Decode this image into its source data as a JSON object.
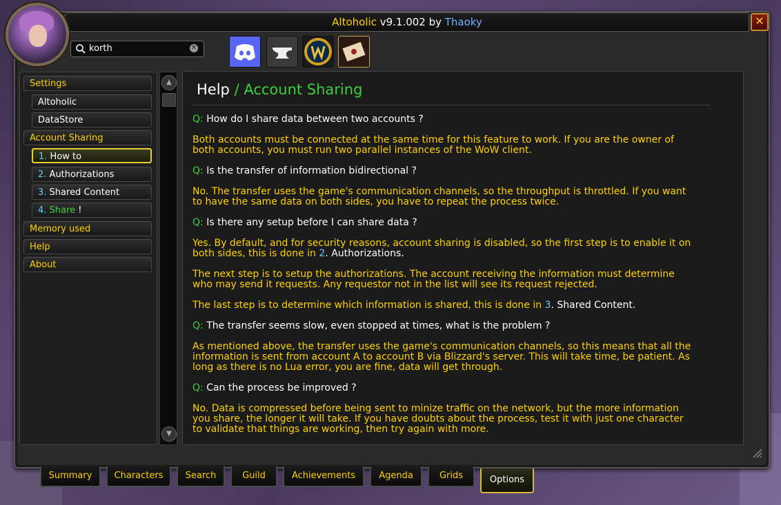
{
  "window": {
    "title_app": "Altoholic",
    "title_version": " v9.1.002 by ",
    "title_author": "Thaoky",
    "close_glyph": "✕"
  },
  "search": {
    "value": "korth",
    "clear_glyph": "✕"
  },
  "toolbar": {
    "buttons": [
      {
        "name": "discord-icon"
      },
      {
        "name": "anvil-icon"
      },
      {
        "name": "wow-logo-icon"
      },
      {
        "name": "scroll-letter-icon"
      }
    ]
  },
  "sidebar": {
    "items": [
      {
        "label": "Settings",
        "kind": "category"
      },
      {
        "label": "Altoholic",
        "kind": "sub"
      },
      {
        "label": "DataStore",
        "kind": "sub"
      },
      {
        "label": "Account Sharing",
        "kind": "category"
      },
      {
        "num": "1.",
        "label": "How to",
        "kind": "sub",
        "selected": true
      },
      {
        "num": "2.",
        "label": "Authorizations",
        "kind": "sub"
      },
      {
        "num": "3.",
        "label": "Shared Content",
        "kind": "sub"
      },
      {
        "num": "4.",
        "label": "Share",
        "suffix": " !",
        "kind": "sub"
      },
      {
        "label": "Memory used",
        "kind": "category"
      },
      {
        "label": "Help",
        "kind": "category"
      },
      {
        "label": "About",
        "kind": "category"
      }
    ]
  },
  "content": {
    "heading_main": "Help",
    "heading_sep": " / ",
    "heading_sub": "Account Sharing",
    "q_label": "Q:",
    "questions": [
      {
        "q": "How do I share data between two accounts ?",
        "a": [
          "Both accounts must be connected at the same time for this feature to work. If you are the owner of",
          "both accounts, you must run two parallel instances of the WoW client."
        ]
      },
      {
        "q": "Is the transfer of information bidirectional ?",
        "a": [
          "No. The transfer uses the game's communication channels, so the throughput is throttled. If you want",
          "to have the same data on both sides, you have to repeat the process twice."
        ]
      },
      {
        "q": "Is there any setup before I can share data ?",
        "a1": "Yes. By default, and for security reasons, account sharing is disabled, so the first step is to enable it on",
        "a2_pre": "both sides, this is done in ",
        "a2_num": "2",
        "a2_post": ". Authorizations.",
        "a3": [
          "The next step is to setup the authorizations. The account receiving the information must determine",
          "who may send it requests. Any requestor not in the list will see its request rejected."
        ],
        "a4_pre": "The last step is to determine which information is shared, this is done in ",
        "a4_num": "3",
        "a4_post": ". Shared Content."
      },
      {
        "q": "The transfer seems slow, even stopped at times, what is the problem ?",
        "a": [
          "As mentioned above, the transfer uses the game's communication channels, so this means that all the",
          "information is sent from account A to account B via Blizzard's server. This will take time, be patient. As",
          "long as there is no Lua error, you are fine, data will get through."
        ]
      },
      {
        "q": "Can the process be improved ?",
        "a": [
          "No. Data is compressed before being sent to minize traffic on the network, but the more information",
          "you share, the longer it will take. If you have doubts about the process, test it with just one character",
          "to validate that things are working, then try again with more."
        ]
      }
    ]
  },
  "tabs": [
    {
      "label": "Summary"
    },
    {
      "label": "Characters"
    },
    {
      "label": "Search"
    },
    {
      "label": "Guild"
    },
    {
      "label": "Achievements"
    },
    {
      "label": "Agenda"
    },
    {
      "label": "Grids"
    },
    {
      "label": "Options",
      "active": true
    }
  ],
  "colors": {
    "gold": "#ffd200",
    "green": "#3cd03c",
    "cyan": "#5ad0ff",
    "discord": "#5865f2"
  }
}
